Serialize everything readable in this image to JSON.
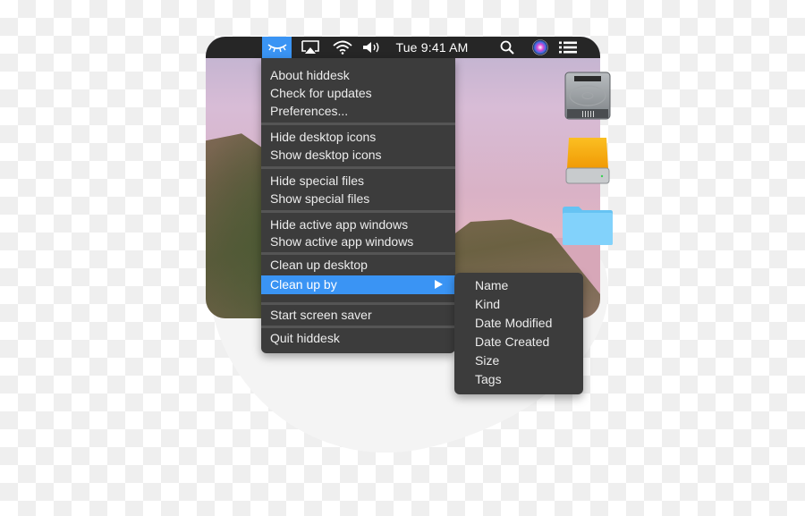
{
  "menubar": {
    "app_icon": "hiddesk-closed-eye-icon",
    "status_icons": [
      "airplay-icon",
      "wifi-icon",
      "volume-icon"
    ],
    "clock": "Tue 9:41 AM",
    "right_icons": [
      "search-icon",
      "siri-icon",
      "notification-center-icon"
    ],
    "accent_color": "#3a94f4"
  },
  "desktop": {
    "icons": [
      {
        "name": "hard-drive-icon"
      },
      {
        "name": "external-drive-icon"
      },
      {
        "name": "folder-icon"
      }
    ]
  },
  "menu": {
    "groups": [
      [
        "About hiddesk",
        "Check for updates",
        "Preferences..."
      ],
      [
        "Hide desktop icons",
        "Show desktop icons"
      ],
      [
        "Hide special files",
        "Show special files"
      ],
      [
        "Hide active app windows",
        "Show active app windows"
      ],
      [
        "Clean up desktop",
        "Clean up by"
      ],
      [
        "Start screen saver"
      ],
      [
        "Quit hiddesk"
      ]
    ],
    "highlighted_item": "Clean up by"
  },
  "submenu": {
    "items": [
      "Name",
      "Kind",
      "Date Modified",
      "Date Created",
      "Size",
      "Tags"
    ]
  }
}
